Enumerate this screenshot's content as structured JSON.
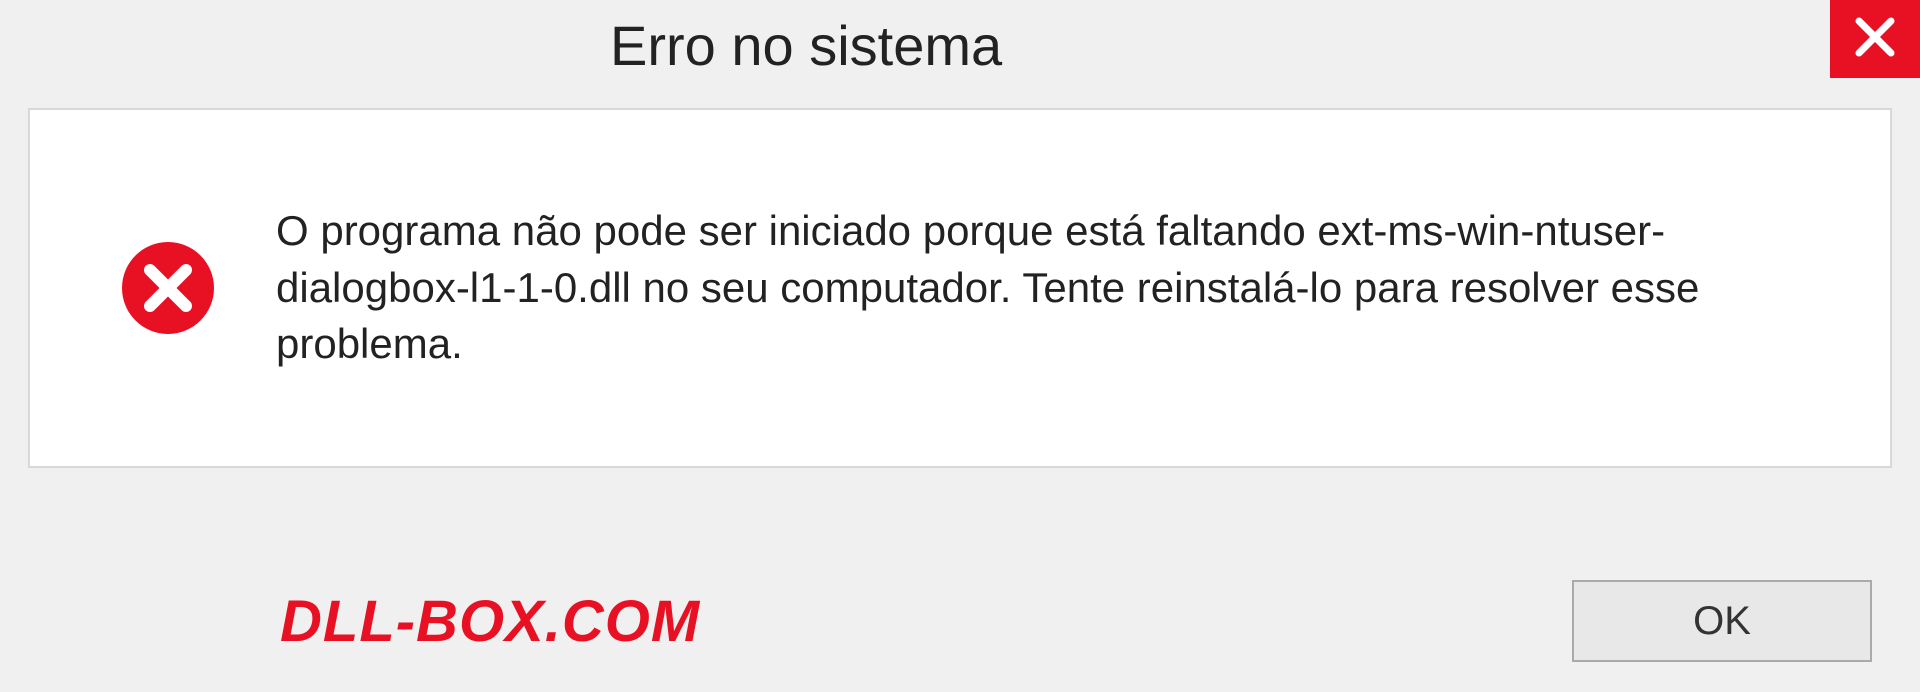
{
  "dialog": {
    "title": "Erro no sistema",
    "message": "O programa não pode ser iniciado porque está faltando ext-ms-win-ntuser-dialogbox-l1-1-0.dll no seu computador. Tente reinstalá-lo para resolver esse problema.",
    "ok_label": "OK"
  },
  "watermark": "DLL-BOX.COM"
}
